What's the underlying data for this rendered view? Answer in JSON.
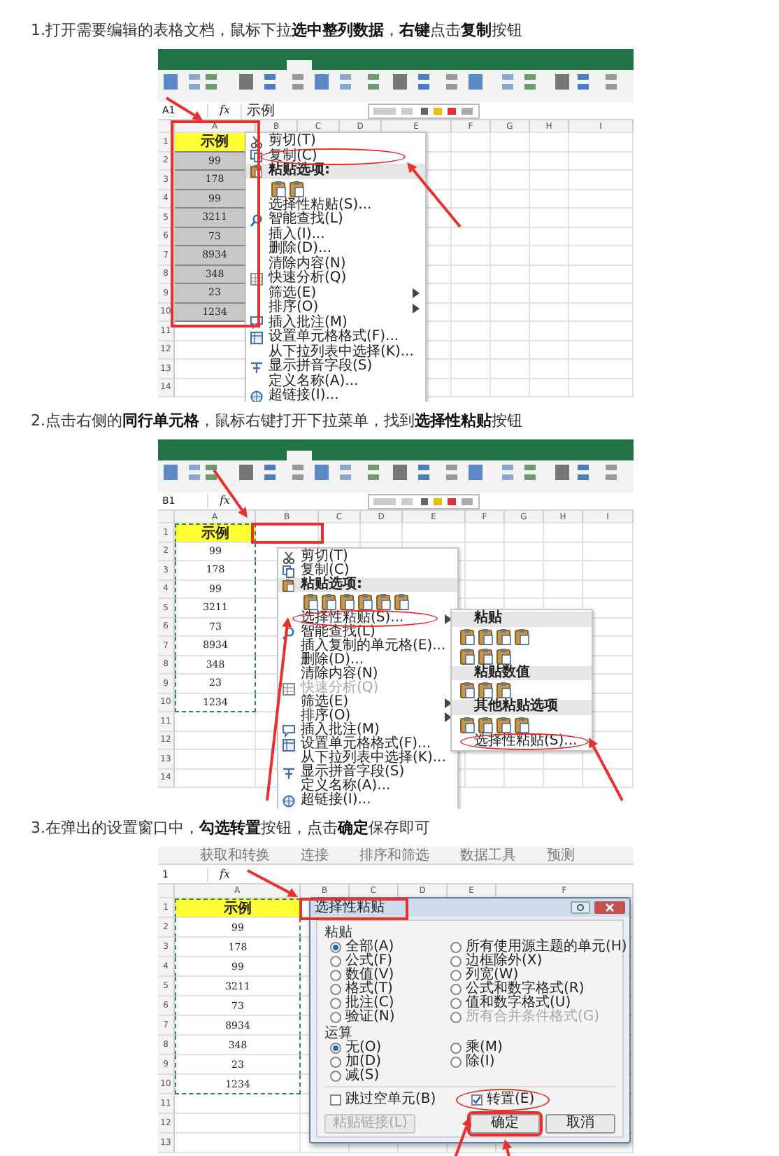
{
  "steps": [
    {
      "caption": "1.打开需要编辑的表格文档，鼠标下拉**选中整列数据**，**右键**点击**复制**按钮",
      "sheet": {
        "ribbon": true,
        "name_box": "A1",
        "function_label": "fx",
        "formula": "示例",
        "columns": [
          "A",
          "B",
          "C",
          "D",
          "E",
          "F",
          "G",
          "H",
          "I"
        ],
        "rows": [
          "1",
          "2",
          "3",
          "4",
          "5",
          "6",
          "7",
          "8",
          "9",
          "10",
          "11",
          "12",
          "13",
          "14"
        ],
        "cells": [
          "示例",
          "99",
          "178",
          "99",
          "3211",
          "73",
          "8934",
          "348",
          "23",
          "1234"
        ],
        "cells_selected": true,
        "copy_marquee": false,
        "context_menu": {
          "items": [
            {
              "kind": "item",
              "label": "剪切(T)",
              "disabled": false,
              "circled": false
            },
            {
              "kind": "item",
              "label": "复制(C)",
              "disabled": false,
              "circled": true
            },
            {
              "kind": "header",
              "label": "粘贴选项:"
            },
            {
              "kind": "icons"
            },
            {
              "kind": "item",
              "label": "选择性粘贴(S)...",
              "disabled": false,
              "circled": false
            },
            {
              "kind": "item",
              "label": "智能查找(L)",
              "disabled": false,
              "circled": false
            },
            {
              "kind": "item",
              "label": "插入(I)...",
              "disabled": false,
              "circled": false
            },
            {
              "kind": "item",
              "label": "删除(D)...",
              "disabled": false,
              "circled": false
            },
            {
              "kind": "item",
              "label": "清除内容(N)",
              "disabled": false,
              "circled": false
            },
            {
              "kind": "item",
              "label": "快速分析(Q)",
              "disabled": false,
              "circled": false
            },
            {
              "kind": "submenu",
              "label": "筛选(E)",
              "disabled": false,
              "circled": false
            },
            {
              "kind": "submenu",
              "label": "排序(O)",
              "disabled": false,
              "circled": false
            },
            {
              "kind": "item",
              "label": "插入批注(M)",
              "disabled": false,
              "circled": false
            },
            {
              "kind": "item",
              "label": "设置单元格格式(F)...",
              "disabled": false,
              "circled": false
            },
            {
              "kind": "item",
              "label": "从下拉列表中选择(K)...",
              "disabled": false,
              "circled": false
            },
            {
              "kind": "item",
              "label": "显示拼音字段(S)",
              "disabled": false,
              "circled": false
            },
            {
              "kind": "item",
              "label": "定义名称(A)...",
              "disabled": false,
              "circled": false
            },
            {
              "kind": "item",
              "label": "超链接(I)...",
              "disabled": false,
              "circled": false
            }
          ]
        }
      }
    },
    {
      "caption": "2.点击右侧的**同行单元格**，鼠标右键打开下拉菜单，找到**选择性粘贴**按钮",
      "sheet": {
        "ribbon": true,
        "name_box": "B1",
        "function_label": "fx",
        "columns": [
          "A",
          "B",
          "C",
          "D",
          "E",
          "F",
          "G",
          "H",
          "I"
        ],
        "rows": [
          "1",
          "2",
          "3",
          "4",
          "5",
          "6",
          "7",
          "8",
          "9",
          "10",
          "11",
          "12",
          "13",
          "14"
        ],
        "cells": [
          "示例",
          "99",
          "178",
          "99",
          "3211",
          "73",
          "8934",
          "348",
          "23",
          "1234"
        ],
        "cells_selected": false,
        "copy_marquee": true,
        "context_menu": {
          "items": [
            {
              "kind": "item",
              "label": "剪切(T)",
              "disabled": false,
              "circled": false
            },
            {
              "kind": "item",
              "label": "复制(C)",
              "disabled": false,
              "circled": false
            },
            {
              "kind": "header",
              "label": "粘贴选项:"
            },
            {
              "kind": "icons"
            },
            {
              "kind": "submenu",
              "label": "选择性粘贴(S)...",
              "disabled": false,
              "circled": true
            },
            {
              "kind": "item",
              "label": "智能查找(L)",
              "disabled": false,
              "circled": false
            },
            {
              "kind": "item",
              "label": "插入复制的单元格(E)...",
              "disabled": false,
              "circled": false
            },
            {
              "kind": "item",
              "label": "删除(D)...",
              "disabled": false,
              "circled": false
            },
            {
              "kind": "item",
              "label": "清除内容(N)",
              "disabled": false,
              "circled": false
            },
            {
              "kind": "item",
              "label": "快速分析(Q)",
              "disabled": true,
              "circled": false
            },
            {
              "kind": "submenu",
              "label": "筛选(E)",
              "disabled": false,
              "circled": false
            },
            {
              "kind": "submenu",
              "label": "排序(O)",
              "disabled": false,
              "circled": false
            },
            {
              "kind": "item",
              "label": "插入批注(M)",
              "disabled": false,
              "circled": false
            },
            {
              "kind": "item",
              "label": "设置单元格格式(F)...",
              "disabled": false,
              "circled": false
            },
            {
              "kind": "item",
              "label": "从下拉列表中选择(K)...",
              "disabled": false,
              "circled": false
            },
            {
              "kind": "item",
              "label": "显示拼音字段(S)",
              "disabled": false,
              "circled": false
            },
            {
              "kind": "item",
              "label": "定义名称(A)...",
              "disabled": false,
              "circled": false
            },
            {
              "kind": "item",
              "label": "超链接(I)...",
              "disabled": false,
              "circled": false
            }
          ]
        },
        "submenu": {
          "items": [
            {
              "kind": "header",
              "label": "粘贴"
            },
            {
              "kind": "icons"
            },
            {
              "kind": "header",
              "label": "粘贴数值"
            },
            {
              "kind": "icons"
            },
            {
              "kind": "header",
              "label": "其他粘贴选项"
            },
            {
              "kind": "icons"
            },
            {
              "kind": "item",
              "label": "选择性粘贴(S)...",
              "disabled": false,
              "circled": true
            }
          ]
        }
      }
    },
    {
      "caption": "3.在弹出的设置窗口中，**勾选转置**按钮，点击**确定**保存即可",
      "sheet": {
        "ribbon": false,
        "groups": [
          "获取和转换",
          "连接",
          "排序和筛选",
          "数据工具",
          "预测"
        ],
        "name_box": "1",
        "function_label": "fx",
        "columns": [
          "A",
          "B",
          "C",
          "D",
          "E",
          "F"
        ],
        "rows": [
          "1",
          "2",
          "3",
          "4",
          "5",
          "6",
          "7",
          "8",
          "9",
          "10",
          "11",
          "12",
          "13"
        ],
        "cells": [
          "示例",
          "99",
          "178",
          "99",
          "3211",
          "73",
          "8934",
          "348",
          "23",
          "1234"
        ],
        "cells_selected": false,
        "copy_marquee": true,
        "dialog": {
          "title": "选择性粘贴",
          "sections": [
            {
              "title": "粘贴",
              "options": [
                {
                  "label": "全部(A)",
                  "selected": true,
                  "disabled": false
                },
                {
                  "label": "所有使用源主题的单元(H)",
                  "selected": false,
                  "disabled": false
                },
                {
                  "label": "公式(F)",
                  "selected": false,
                  "disabled": false
                },
                {
                  "label": "边框除外(X)",
                  "selected": false,
                  "disabled": false
                },
                {
                  "label": "数值(V)",
                  "selected": false,
                  "disabled": false
                },
                {
                  "label": "列宽(W)",
                  "selected": false,
                  "disabled": false
                },
                {
                  "label": "格式(T)",
                  "selected": false,
                  "disabled": false
                },
                {
                  "label": "公式和数字格式(R)",
                  "selected": false,
                  "disabled": false
                },
                {
                  "label": "批注(C)",
                  "selected": false,
                  "disabled": false
                },
                {
                  "label": "值和数字格式(U)",
                  "selected": false,
                  "disabled": false
                },
                {
                  "label": "验证(N)",
                  "selected": false,
                  "disabled": false
                },
                {
                  "label": "所有合并条件格式(G)",
                  "selected": false,
                  "disabled": true
                }
              ]
            },
            {
              "title": "运算",
              "options": [
                {
                  "label": "无(O)",
                  "selected": true,
                  "disabled": false
                },
                {
                  "label": "乘(M)",
                  "selected": false,
                  "disabled": false
                },
                {
                  "label": "加(D)",
                  "selected": false,
                  "disabled": false
                },
                {
                  "label": "除(I)",
                  "selected": false,
                  "disabled": false
                },
                {
                  "label": "减(S)",
                  "selected": false,
                  "disabled": false
                }
              ]
            }
          ],
          "checks": [
            {
              "label": "跳过空单元(B)",
              "checked": false,
              "circled": false
            },
            {
              "label": "转置(E)",
              "checked": true,
              "circled": true
            }
          ],
          "buttons": [
            {
              "label": "粘贴链接(L)",
              "disabled": true,
              "boxed": false
            },
            {
              "label": "确定",
              "disabled": false,
              "boxed": true
            },
            {
              "label": "取消",
              "disabled": false,
              "boxed": false
            }
          ]
        }
      }
    }
  ]
}
